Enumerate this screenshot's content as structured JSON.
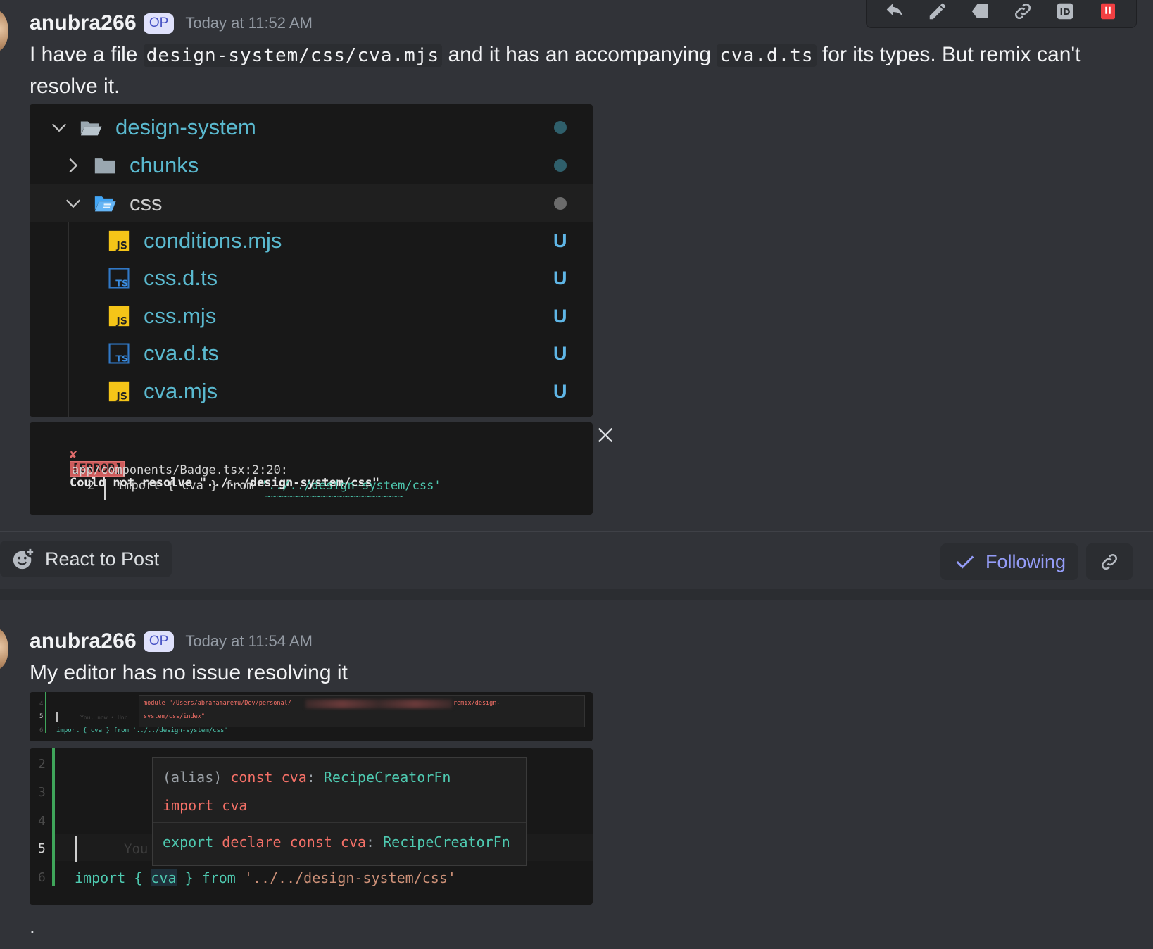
{
  "toolbar": {
    "icons": [
      "reply-icon",
      "edit-icon",
      "forward-icon",
      "link-icon",
      "id-icon",
      "delete-icon"
    ]
  },
  "message1": {
    "username": "anubra266",
    "badge": "OP",
    "timestamp": "Today at 11:52 AM",
    "text_before": "I have a file ",
    "code1": "design-system/css/cva.mjs",
    "text_middle": " and it has an accompanying ",
    "code2": "cva.d.ts",
    "text_after": " for its types. But remix can't",
    "text_line2": "resolve it."
  },
  "file_tree": {
    "items": [
      {
        "name": "design-system",
        "type": "folder-open",
        "status": "dot"
      },
      {
        "name": "chunks",
        "type": "folder",
        "status": "dot"
      },
      {
        "name": "css",
        "type": "folder-open",
        "status": "dot"
      },
      {
        "name": "conditions.mjs",
        "type": "js",
        "status": "U"
      },
      {
        "name": "css.d.ts",
        "type": "ts",
        "status": "U"
      },
      {
        "name": "css.mjs",
        "type": "js",
        "status": "U"
      },
      {
        "name": "cva.d.ts",
        "type": "ts",
        "status": "U"
      },
      {
        "name": "cva.mjs",
        "type": "js",
        "status": "U"
      }
    ]
  },
  "error": {
    "mark": "✘",
    "tag": "[ERROR]",
    "message": "Could not resolve \"../../design-system/css\"",
    "location": "app/components/Badge.tsx:2:20:",
    "line_no": "2",
    "code_before": "import { cva } from ",
    "code_string": "'../../design-system/css'",
    "underline": "~~~~~~~~~~~~~~~~~~~~~~~~~"
  },
  "actions": {
    "react_label": "React to Post",
    "following_label": "Following"
  },
  "message2": {
    "username": "anubra266",
    "badge": "OP",
    "timestamp": "Today at 11:54 AM",
    "text": "My editor has no issue resolving it",
    "trailing": "."
  },
  "editor_small": {
    "module_path_start": "module \"/Users/abrahamaremu/Dev/personal/",
    "module_path_end": "remix/design-",
    "module_path_line2": "system/css/index\"",
    "gutter": [
      "4",
      "5",
      "6"
    ],
    "ghost_text": "You, now • Unc",
    "code_line": "import { cva } from '../../design-system/css'"
  },
  "editor_large": {
    "gutter": [
      "2",
      "3",
      "4",
      "5",
      "6"
    ],
    "ghost_text": "You",
    "popup_line1_alias": "(alias)",
    "popup_line1_const": "const",
    "popup_line1_name": "cva",
    "popup_line1_type": "RecipeCreatorFn",
    "popup_line2_import": "import",
    "popup_line2_name": "cva",
    "popup_line3_export": "export",
    "popup_line3_declare": "declare",
    "popup_line3_const": "const",
    "popup_line3_name": "cva",
    "popup_line3_type": "RecipeCreatorFn",
    "code_import": "import",
    "code_open": "{",
    "code_name": "cva",
    "code_close": "}",
    "code_from": "from",
    "code_string": "'../../design-system/css'"
  },
  "colors": {
    "background": "#313338",
    "accent": "#949cf7",
    "op_badge": "#dfe1fb",
    "delete": "#f23f42"
  }
}
